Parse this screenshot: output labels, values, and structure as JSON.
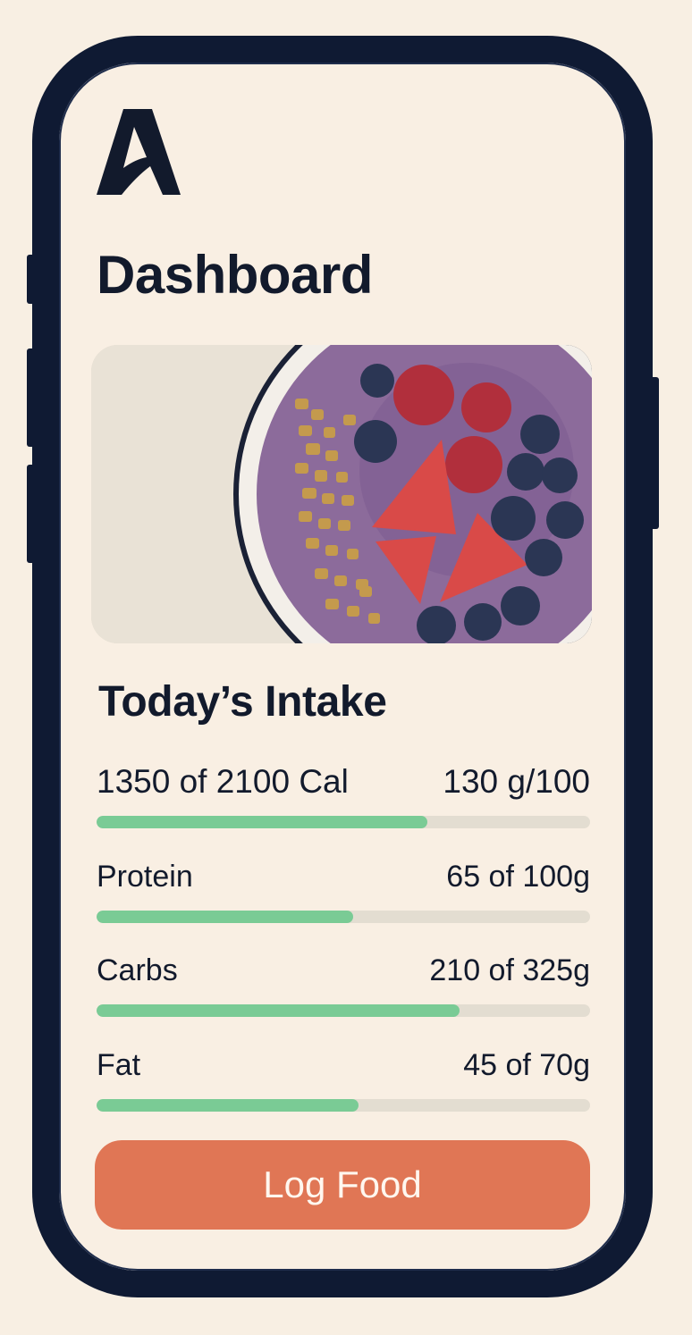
{
  "app": {
    "logo_icon": "stylized-letter-a-logo",
    "accent_color": "#e07655",
    "progress_color": "#7acb95",
    "frame_color": "#0f1a33"
  },
  "header": {
    "title": "Dashboard"
  },
  "hero": {
    "image": "acai-bowl-with-berries-and-granola"
  },
  "intake": {
    "title": "Today’s Intake",
    "rows": [
      {
        "label": "1350 of 2100 Cal",
        "value": "130 g/100",
        "progress": 0.67
      },
      {
        "label": "Protein",
        "value": "65 of 100g",
        "progress": 0.52
      },
      {
        "label": "Carbs",
        "value": "210 of 325g",
        "progress": 0.735
      },
      {
        "label": "Fat",
        "value": "45 of 70g",
        "progress": 0.53
      }
    ]
  },
  "action": {
    "log_label": "Log Food"
  }
}
